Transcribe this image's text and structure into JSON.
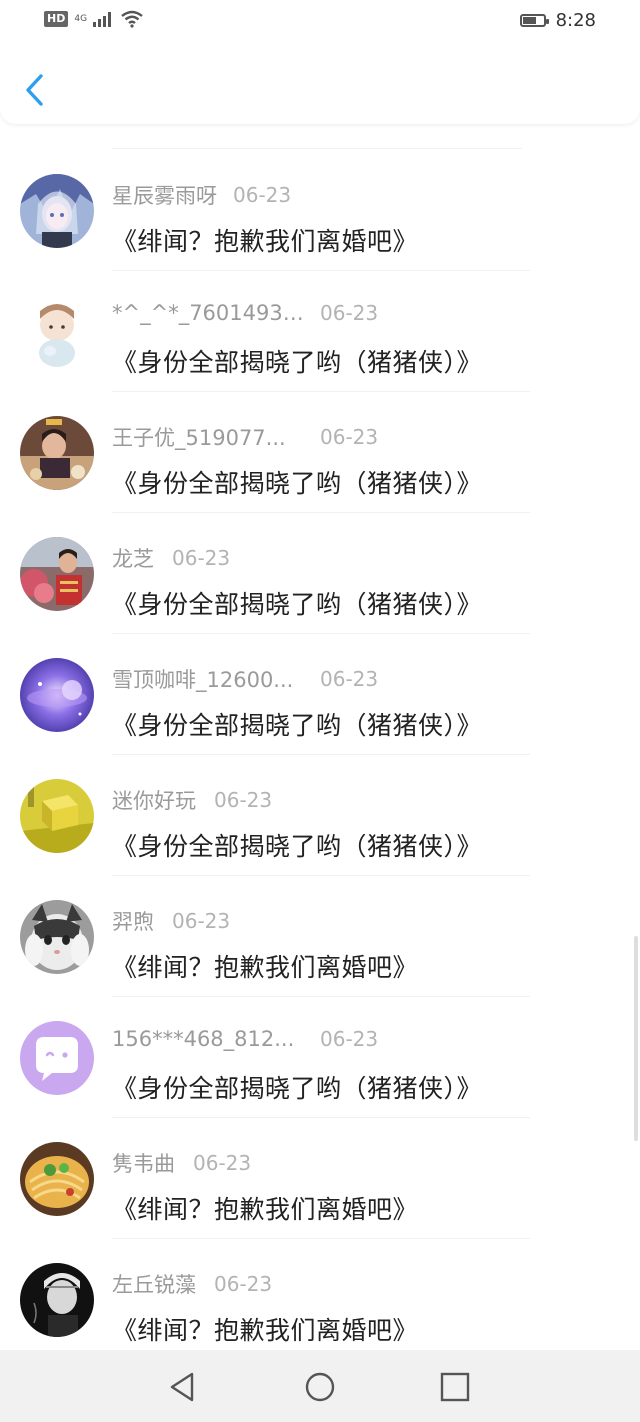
{
  "status_bar": {
    "hd_label": "HD",
    "network_label": "4G",
    "time": "8:28"
  },
  "header": {
    "back_icon": "chevron-left-icon",
    "accent_color": "#2d9ff0"
  },
  "comments": [
    {
      "user": "星辰雾雨呀",
      "date": "06-23",
      "message": "《绯闻？抱歉我们离婚吧》",
      "avatar": "anime-girl-avatar"
    },
    {
      "user": "*^_^*_76014932...",
      "date": "06-23",
      "message": "《身份全部揭晓了哟（猪猪侠）》",
      "avatar": "cartoon-boy-avatar"
    },
    {
      "user": "王子优_519077...",
      "date": "06-23",
      "message": "《身份全部揭晓了哟（猪猪侠）》",
      "avatar": "photo-child-avatar"
    },
    {
      "user": "龙芝",
      "date": "06-23",
      "message": "《身份全部揭晓了哟（猪猪侠）》",
      "avatar": "photo-flowers-avatar"
    },
    {
      "user": "雪顶咖啡_12600...",
      "date": "06-23",
      "message": "《身份全部揭晓了哟（猪猪侠）》",
      "avatar": "purple-galaxy-avatar"
    },
    {
      "user": "迷你好玩",
      "date": "06-23",
      "message": "《身份全部揭晓了哟（猪猪侠）》",
      "avatar": "yellow-block-avatar"
    },
    {
      "user": "羿煦",
      "date": "06-23",
      "message": "《绯闻？抱歉我们离婚吧》",
      "avatar": "cat-avatar"
    },
    {
      "user": "156***468_812...",
      "date": "06-23",
      "message": "《身份全部揭晓了哟（猪猪侠）》",
      "avatar": "default-chat-avatar"
    },
    {
      "user": "隽韦曲",
      "date": "06-23",
      "message": "《绯闻？抱歉我们离婚吧》",
      "avatar": "food-avatar"
    },
    {
      "user": "左丘锐藻",
      "date": "06-23",
      "message": "《绯闻？抱歉我们离婚吧》",
      "avatar": "bw-portrait-avatar"
    }
  ],
  "nav_bar": {
    "back": "triangle-back-icon",
    "home": "circle-home-icon",
    "recents": "square-recents-icon"
  }
}
